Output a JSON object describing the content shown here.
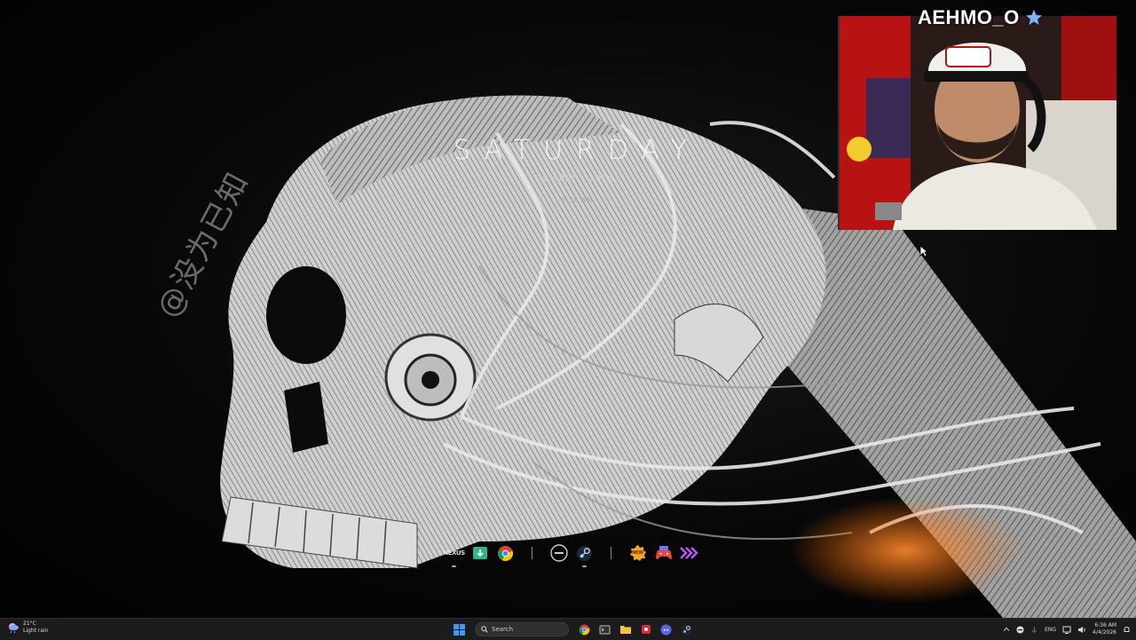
{
  "desktop": {
    "watermark": "@没为已知",
    "day": "SATURDAY",
    "date": "04  APRIL,  2026.",
    "time": "- 6:36 AM -"
  },
  "dock": {
    "left_group": [
      "nexus-mods",
      "download-manager",
      "chrome"
    ],
    "middle_group": [
      "zeus-launcher",
      "steam"
    ],
    "right_group": [
      "new-badge-app",
      "gamepad-app",
      "forward-app"
    ],
    "nexus_label": "NEXUS",
    "new_label": "NEW"
  },
  "stream": {
    "streamer_name": "AEHMO_O",
    "badge_color": "#7fb2ff"
  },
  "taskbar": {
    "weather_temp": "21°C",
    "weather_desc": "Light rain",
    "search_placeholder": "Search",
    "pinned": [
      "chrome",
      "terminal",
      "file-explorer",
      "app-red",
      "discord",
      "steam"
    ],
    "language": "ENG",
    "clock_time": "6:36 AM",
    "clock_date": "4/4/2026"
  },
  "colors": {
    "taskbar_bg": "#1c1c1c",
    "win_blue": "#3a9bff",
    "webcam_red": "#b81212"
  }
}
